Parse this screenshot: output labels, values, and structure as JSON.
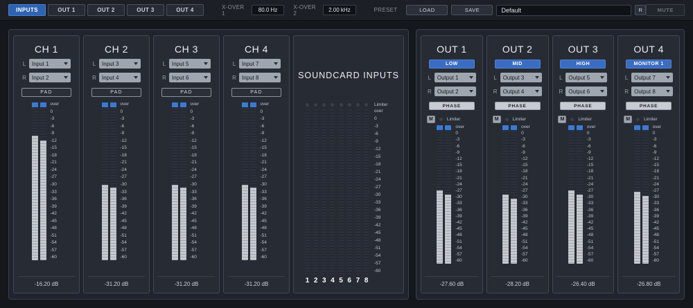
{
  "topbar": {
    "tabs": [
      {
        "label": "INPUTS"
      },
      {
        "label": "OUT 1"
      },
      {
        "label": "OUT 2"
      },
      {
        "label": "OUT 3"
      },
      {
        "label": "OUT 4"
      }
    ],
    "xover1_label": "X-OVER 1",
    "xover1_value": "80.0 Hz",
    "xover2_label": "X-OVER 2",
    "xover2_value": "2.00 kHz",
    "preset_label": "PRESET",
    "load_label": "LOAD",
    "save_label": "SAVE",
    "preset_name": "Default",
    "recall_label": "R",
    "mute_label": "MUTE"
  },
  "scale": [
    "over",
    "0",
    "-3",
    "-6",
    "-9",
    "-12",
    "-15",
    "-18",
    "-21",
    "-24",
    "-27",
    "-30",
    "-33",
    "-36",
    "-39",
    "-42",
    "-45",
    "-48",
    "-51",
    "-54",
    "-57",
    "-60"
  ],
  "channels": [
    {
      "title": "CH 1",
      "l_label": "L",
      "r_label": "R",
      "input_l": "Input 1",
      "input_r": "Input 2",
      "pad_label": "PAD",
      "readout": "-16.20 dB",
      "level_l": 79,
      "level_r": 76
    },
    {
      "title": "CH 2",
      "l_label": "L",
      "r_label": "R",
      "input_l": "Input 3",
      "input_r": "Input 4",
      "pad_label": "PAD",
      "readout": "-31.20 dB",
      "level_l": 48,
      "level_r": 46
    },
    {
      "title": "CH 3",
      "l_label": "L",
      "r_label": "R",
      "input_l": "Input 5",
      "input_r": "Input 6",
      "pad_label": "PAD",
      "readout": "-31.20 dB",
      "level_l": 48,
      "level_r": 46
    },
    {
      "title": "CH 4",
      "l_label": "L",
      "r_label": "R",
      "input_l": "Input 7",
      "input_r": "Input 8",
      "pad_label": "PAD",
      "readout": "-31.20 dB",
      "level_l": 48,
      "level_r": 46
    }
  ],
  "soundcard": {
    "title": "SOUNDCARD INPUTS",
    "limiter_label": "Limiter",
    "channel_numbers": [
      "1",
      "2",
      "3",
      "4",
      "5",
      "6",
      "7",
      "8"
    ],
    "levels": [
      0,
      0,
      0,
      0,
      0,
      0,
      0,
      0
    ]
  },
  "outputs": [
    {
      "title": "OUT 1",
      "band_label": "LOW",
      "l_label": "L",
      "r_label": "R",
      "output_l": "Output 1",
      "output_r": "Output 2",
      "phase_label": "PHASE",
      "mute_label": "M",
      "limiter_label": "Limiter",
      "readout": "-27.60 dB",
      "level_l": 53,
      "level_r": 50
    },
    {
      "title": "OUT 2",
      "band_label": "MID",
      "l_label": "L",
      "r_label": "R",
      "output_l": "Output 3",
      "output_r": "Output 4",
      "phase_label": "PHASE",
      "mute_label": "M",
      "limiter_label": "Limiter",
      "readout": "-28.20 dB",
      "level_l": 50,
      "level_r": 47
    },
    {
      "title": "OUT 3",
      "band_label": "HIGH",
      "l_label": "L",
      "r_label": "R",
      "output_l": "Output 5",
      "output_r": "Output 6",
      "phase_label": "PHASE",
      "mute_label": "M",
      "limiter_label": "Limiter",
      "readout": "-26.40 dB",
      "level_l": 53,
      "level_r": 50
    },
    {
      "title": "OUT 4",
      "band_label": "MONITOR 1",
      "l_label": "L",
      "r_label": "R",
      "output_l": "Output 7",
      "output_r": "Output 8",
      "phase_label": "PHASE",
      "mute_label": "M",
      "limiter_label": "Limiter",
      "readout": "-26.80 dB",
      "level_l": 52,
      "level_r": 49
    }
  ]
}
